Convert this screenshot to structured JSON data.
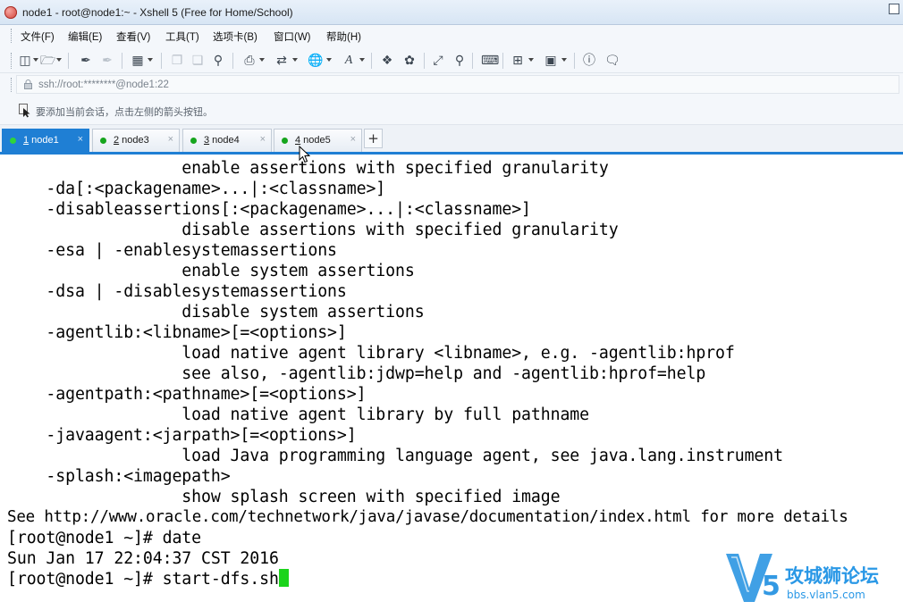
{
  "window": {
    "title": "node1 - root@node1:~ - Xshell 5 (Free for Home/School)"
  },
  "menubar": {
    "items": [
      "文件(F)",
      "编辑(E)",
      "查看(V)",
      "工具(T)",
      "选项卡(B)",
      "窗口(W)",
      "帮助(H)"
    ]
  },
  "address": {
    "value": "ssh://root:********@node1:22"
  },
  "hint": {
    "text": "要添加当前会话，点击左侧的箭头按钮。"
  },
  "tabs": [
    {
      "num": "1",
      "name": " node1",
      "active": true
    },
    {
      "num": "2",
      "name": " node3",
      "active": false
    },
    {
      "num": "3",
      "name": " node4",
      "active": false
    },
    {
      "num": "4",
      "name": " node5",
      "active": false
    }
  ],
  "tab_add_label": "+",
  "tab_close_glyph": "×",
  "terminal": {
    "lines": [
      "                  enable assertions with specified granularity",
      "    -da[:<packagename>...|:<classname>]",
      "    -disableassertions[:<packagename>...|:<classname>]",
      "                  disable assertions with specified granularity",
      "    -esa | -enablesystemassertions",
      "                  enable system assertions",
      "    -dsa | -disablesystemassertions",
      "                  disable system assertions",
      "    -agentlib:<libname>[=<options>]",
      "                  load native agent library <libname>, e.g. -agentlib:hprof",
      "                  see also, -agentlib:jdwp=help and -agentlib:hprof=help",
      "    -agentpath:<pathname>[=<options>]",
      "                  load native agent library by full pathname",
      "    -javaagent:<jarpath>[=<options>]",
      "                  load Java programming language agent, see java.lang.instrument",
      "    -splash:<imagepath>",
      "                  show splash screen with specified image",
      "See http://www.oracle.com/technetwork/java/javase/documentation/index.html for more details",
      "[root@node1 ~]# date",
      "Sun Jan 17 22:04:37 CST 2016",
      "[root@node1 ~]# start-dfs.sh"
    ],
    "cursor_color": "#1bd41b"
  },
  "watermark": {
    "brand_cn": "攻城狮论坛",
    "url": "bbs.vlan5.com"
  },
  "colors": {
    "accent": "#1f7fd4",
    "tab_dot": "#16a51d",
    "watermark_blue": "#1e8fe0"
  },
  "toolbar_icons": [
    "new-session-icon",
    "open-folder-icon",
    "reconnect-icon",
    "disconnect-icon",
    "properties-icon",
    "copy-icon",
    "paste-icon",
    "find-icon",
    "print-icon",
    "transfer-icon",
    "globe-icon",
    "font-icon",
    "xftp-icon",
    "xmanager-icon",
    "fullscreen-icon",
    "lock-icon",
    "keyboard-icon",
    "new-tab-icon",
    "layout-icon",
    "help-icon",
    "chat-icon"
  ]
}
